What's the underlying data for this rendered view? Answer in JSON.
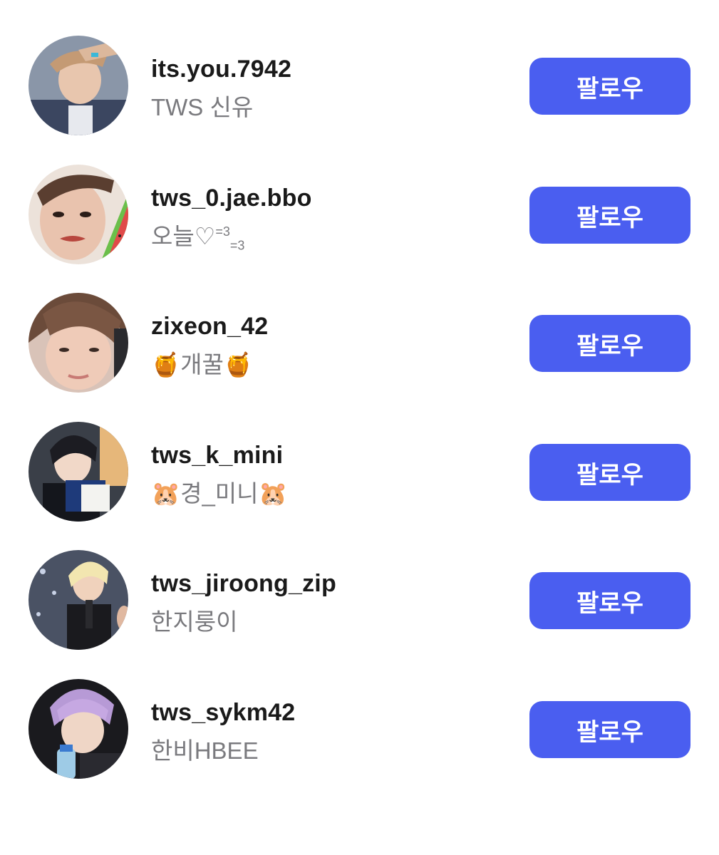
{
  "accounts": [
    {
      "username": "its.you.7942",
      "display_name": "TWS 신유",
      "follow_label": "팔로우"
    },
    {
      "username": "tws_0.jae.bbo",
      "display_name": "오늘♡",
      "display_sup": "=3",
      "display_sub": "=3",
      "follow_label": "팔로우"
    },
    {
      "username": "zixeon_42",
      "display_name": "🍯개꿀🍯",
      "follow_label": "팔로우"
    },
    {
      "username": "tws_k_mini",
      "display_name": "🐹경_미니🐹",
      "follow_label": "팔로우"
    },
    {
      "username": "tws_jiroong_zip",
      "display_name": "한지룽이",
      "follow_label": "팔로우"
    },
    {
      "username": "tws_sykm42",
      "display_name": "한비HBEE",
      "follow_label": "팔로우"
    }
  ],
  "colors": {
    "follow_button": "#4a5ef0",
    "username_text": "#1a1a1a",
    "display_name_text": "#7a7a7e"
  }
}
